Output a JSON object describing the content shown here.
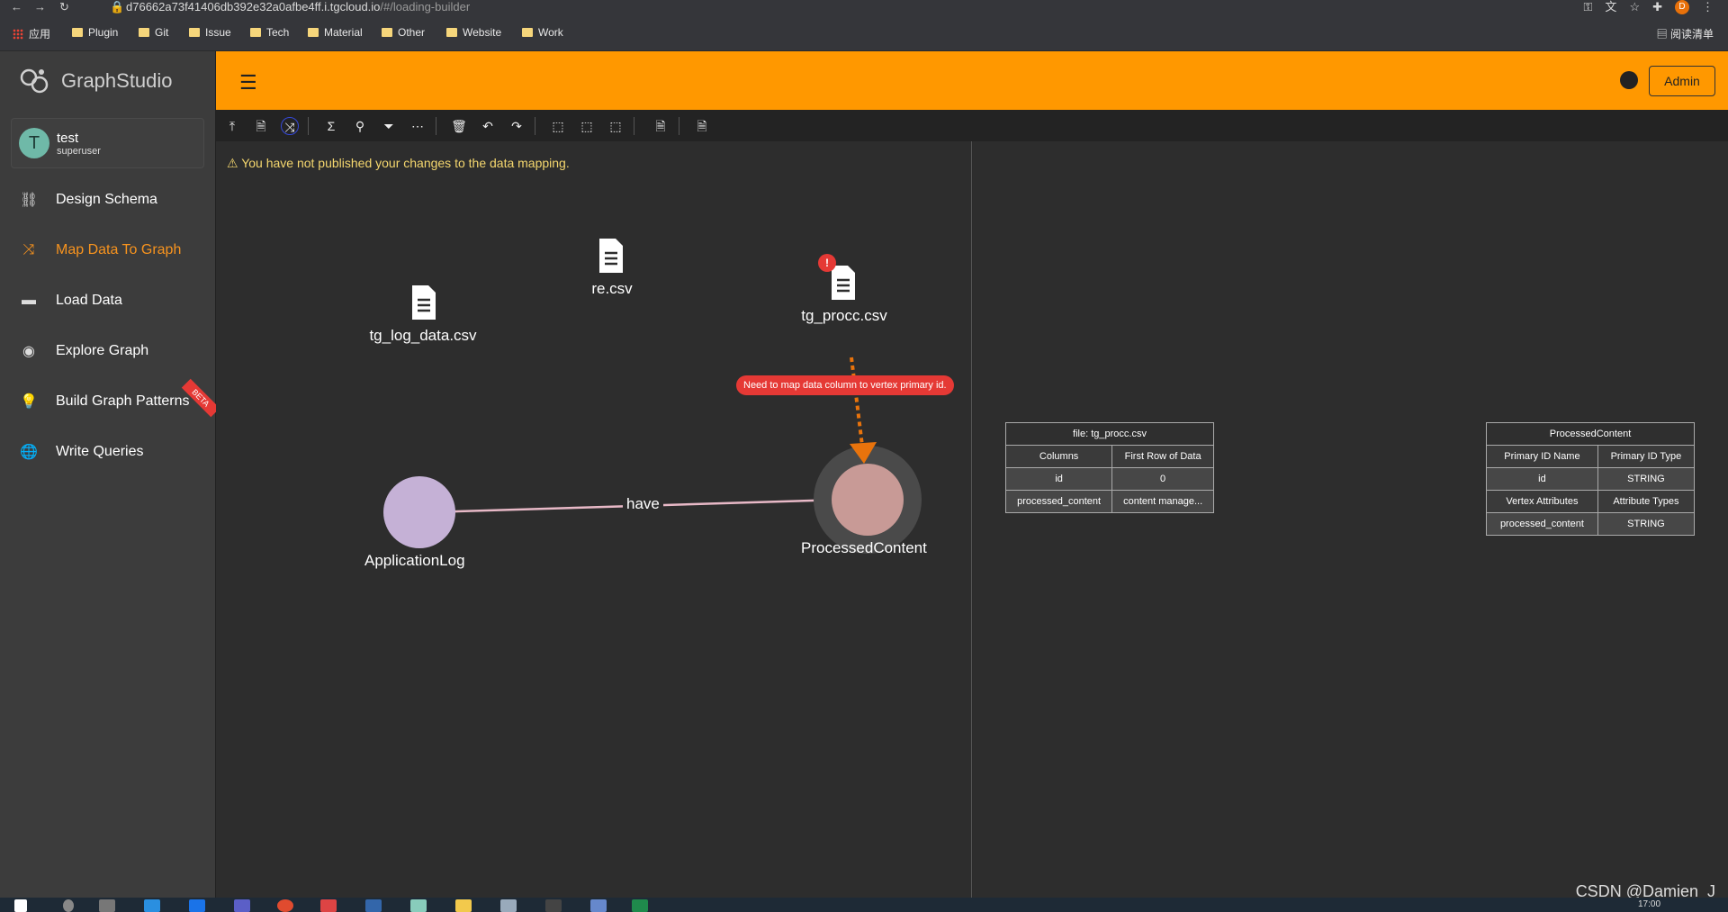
{
  "browser": {
    "url_host": "d76662a73f41406db392e32a0afbe4ff.i.tgcloud.io",
    "url_path": "/#/loading-builder",
    "profile_initial": "D",
    "bookmarks": [
      "应用",
      "Plugin",
      "Git",
      "Issue",
      "Tech",
      "Material",
      "Other",
      "Website",
      "Work"
    ],
    "reading_list": "阅读清单"
  },
  "app": {
    "logo_text": "GraphStudio",
    "admin_button": "Admin",
    "user": {
      "initial": "T",
      "name": "test",
      "role": "superuser"
    },
    "nav": [
      {
        "label": "Design Schema",
        "icon": "schema-icon",
        "active": false
      },
      {
        "label": "Map Data To Graph",
        "icon": "shuffle-icon",
        "active": true
      },
      {
        "label": "Load Data",
        "icon": "load-icon",
        "active": false
      },
      {
        "label": "Explore Graph",
        "icon": "compass-icon",
        "active": false
      },
      {
        "label": "Build Graph Patterns",
        "icon": "lightbulb-icon",
        "active": false,
        "badge": "BETA"
      },
      {
        "label": "Write Queries",
        "icon": "globe-icon",
        "active": false
      }
    ]
  },
  "toolbar": {
    "buttons": [
      "publish",
      "add-file",
      "map-data",
      "sum",
      "suggest",
      "filter",
      "more",
      "delete",
      "undo",
      "redo",
      "select-1",
      "select-2",
      "select-3",
      "doc-1",
      "doc-2"
    ]
  },
  "canvas": {
    "warning": "You have not published your changes to the data mapping.",
    "files": [
      "tg_log_data.csv",
      "re.csv",
      "tg_procc.csv"
    ],
    "error_badge": "!",
    "error_tip": "Need to map data column to vertex primary id.",
    "vertices": [
      "ApplicationLog",
      "ProcessedContent"
    ],
    "edge_label": "have",
    "colors": {
      "applicationlog": "#c5b1d6",
      "processedcontent": "#c89a96",
      "mapping_line": "#e8730c",
      "edge": "#e8b9c7",
      "accent": "#ff9800"
    }
  },
  "file_table": {
    "title": "file: tg_procc.csv",
    "headers": [
      "Columns",
      "First Row of Data"
    ],
    "rows": [
      [
        "id",
        "0"
      ],
      [
        "processed_content",
        "content manage..."
      ]
    ]
  },
  "vertex_table": {
    "title": "ProcessedContent",
    "headers": [
      "Primary ID Name",
      "Primary ID Type"
    ],
    "id_row": [
      "id",
      "STRING"
    ],
    "attr_headers": [
      "Vertex Attributes",
      "Attribute Types"
    ],
    "attr_rows": [
      [
        "processed_content",
        "STRING"
      ]
    ]
  },
  "watermark": "CSDN @Damien_J",
  "clock": "17:00"
}
